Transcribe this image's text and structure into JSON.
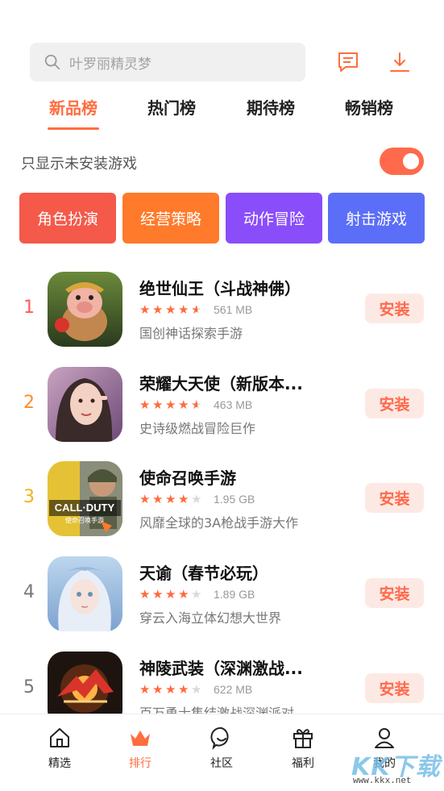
{
  "search": {
    "placeholder": "叶罗丽精灵梦"
  },
  "header_icons": {
    "message": "message-icon",
    "download": "download-icon"
  },
  "tabs": [
    {
      "label": "新品榜",
      "active": true
    },
    {
      "label": "热门榜",
      "active": false
    },
    {
      "label": "期待榜",
      "active": false
    },
    {
      "label": "畅销榜",
      "active": false
    }
  ],
  "filter": {
    "label": "只显示未安装游戏",
    "enabled": true
  },
  "categories": [
    {
      "label": "角色扮演",
      "color": "#f4594a"
    },
    {
      "label": "经营策略",
      "color": "#ff7a2a"
    },
    {
      "label": "动作冒险",
      "color": "#8a4dfa"
    },
    {
      "label": "射击游戏",
      "color": "#5b6ef8"
    }
  ],
  "games": [
    {
      "rank": "1",
      "rank_color": "#ff5a5a",
      "title": "绝世仙王（斗战神佛）",
      "rating": 4.5,
      "size": "561 MB",
      "desc": "国创神话探索手游",
      "install": "安装"
    },
    {
      "rank": "2",
      "rank_color": "#ff8d2a",
      "title": "荣耀大天使（新版本...",
      "rating": 4.5,
      "size": "463 MB",
      "desc": "史诗级燃战冒险巨作",
      "install": "安装"
    },
    {
      "rank": "3",
      "rank_color": "#f4b11a",
      "title": "使命召唤手游",
      "rating": 4,
      "size": "1.95 GB",
      "desc": "风靡全球的3A枪战手游大作",
      "install": "安装",
      "icon_text": "CALL·DUTY",
      "icon_subtext": "使命召唤手游"
    },
    {
      "rank": "4",
      "rank_color": "#777777",
      "title": "天谕（春节必玩）",
      "rating": 4,
      "size": "1.89 GB",
      "desc": "穿云入海立体幻想大世界",
      "install": "安装"
    },
    {
      "rank": "5",
      "rank_color": "#777777",
      "title": "神陵武装（深渊激战...",
      "rating": 4,
      "size": "622 MB",
      "desc": "百万勇士集结激战深渊派对",
      "install": "安装"
    }
  ],
  "bottom_nav": [
    {
      "label": "精选",
      "icon": "home-icon",
      "active": false
    },
    {
      "label": "排行",
      "icon": "crown-icon",
      "active": true
    },
    {
      "label": "社区",
      "icon": "community-icon",
      "active": false
    },
    {
      "label": "福利",
      "icon": "gift-icon",
      "active": false
    },
    {
      "label": "我的",
      "icon": "user-icon",
      "active": false
    }
  ],
  "watermark": {
    "text": "KK下载",
    "url": "www.kkx.net"
  },
  "colors": {
    "accent": "#ff6d3f",
    "star": "#ff6a3d",
    "star_empty": "#d9d9d9"
  }
}
